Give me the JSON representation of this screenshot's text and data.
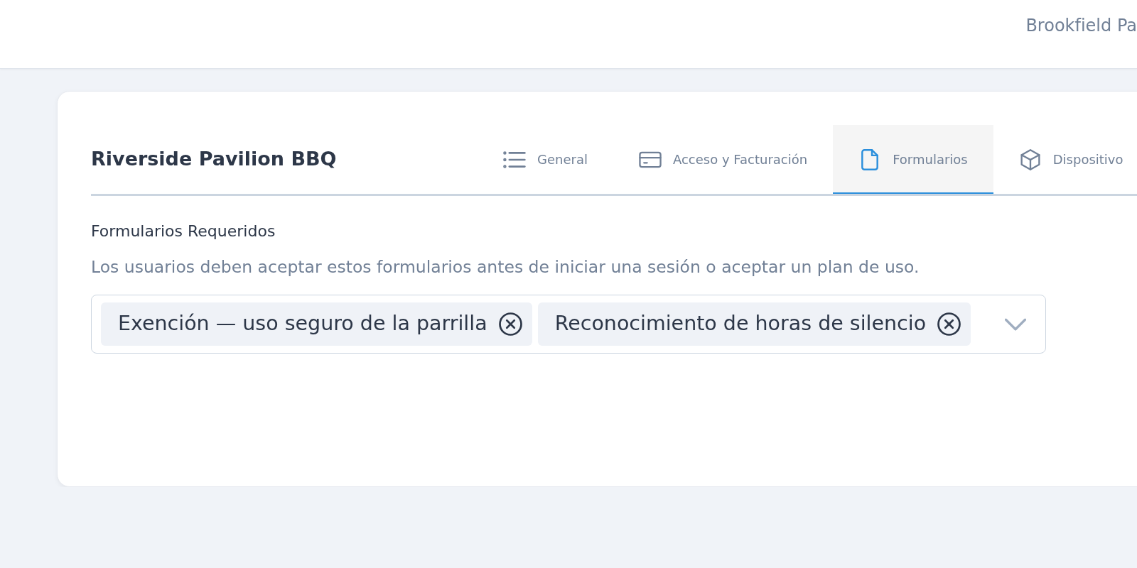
{
  "header": {
    "subtitle": "Brookfield Pa"
  },
  "card": {
    "title": "Riverside Pavilion BBQ",
    "tabs": [
      {
        "label": "General",
        "selected": false
      },
      {
        "label": "Acceso y Facturación",
        "selected": false
      },
      {
        "label": "Formularios",
        "selected": true
      },
      {
        "label": "Dispositivo",
        "selected": false
      }
    ],
    "field": {
      "label": "Formularios Requeridos",
      "help": "Los usuarios deben aceptar estos formularios antes de iniciar una sesión o aceptar un plan de uso.",
      "chips": [
        {
          "label": "Exención — uso seguro de la parrilla"
        },
        {
          "label": "Reconocimiento de horas de silencio"
        }
      ]
    }
  }
}
